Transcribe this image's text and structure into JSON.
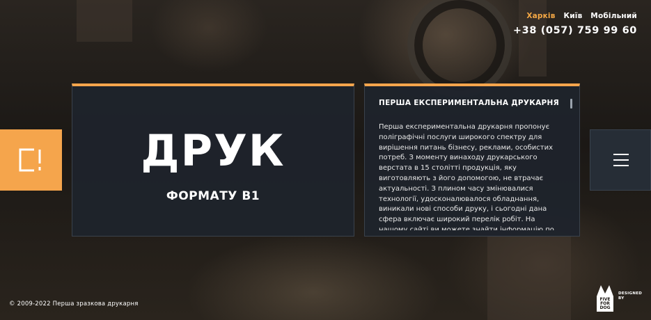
{
  "header": {
    "cities": [
      {
        "label": "Харків",
        "active": true
      },
      {
        "label": "Київ",
        "active": false
      },
      {
        "label": "Мобільний",
        "active": false
      }
    ],
    "phone": "+38 (057) 759 99 60"
  },
  "hero": {
    "title": "ДРУК",
    "subtitle": "ФОРМАТУ В1"
  },
  "info": {
    "heading": "ПЕРША ЕКСПЕРИМЕНТАЛЬНА ДРУКАРНЯ",
    "body": "Перша експериментальна друкарня пропонує поліграфічні послуги широкого спектру для вирішення питань бізнесу, реклами, особистих потреб. З моменту винаходу друкарського верстата в 15 столітті продукція, яку виготовляють з його допомогою, не втрачає актуальності. З плином часу змінювалися технології, удосконалювалося обладнання, виникали нові способи друку, і сьогодні дана сфера включає широкий перелік робіт. На нашому сайті ви можете знайти інформацію по всім друкарським послугам, які наша друкарня виконує"
  },
  "footer": {
    "copyright": "© 2009-2022 Перша зразкова друкарня",
    "designer_brand": [
      "FIVE",
      "FOR",
      "DOG"
    ],
    "designer_label": [
      "DESIGNED",
      "BY"
    ]
  },
  "icons": {
    "logo": "bracket-square-icon",
    "menu": "hamburger-menu-icon",
    "designer": "dog-logo-icon"
  },
  "colors": {
    "accent": "#f5a54c",
    "card_bg": "#1e242c",
    "active_city": "#f5a845"
  }
}
